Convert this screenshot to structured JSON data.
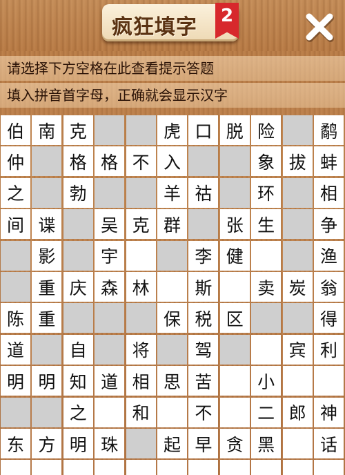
{
  "header": {
    "title": "疯狂填字",
    "level": "2",
    "close_icon": "close-x-icon"
  },
  "hints": {
    "line1": "请选择下方空格在此查看提示答题",
    "line2": "填入拼音首字母，正确就会显示汉字"
  },
  "colors": {
    "wood": "#b97b45",
    "plaque": "#f6e6c8",
    "badge_red": "#d7282c",
    "cell_white": "#ffffff",
    "cell_empty": "#cfcfcf",
    "text": "#111111"
  },
  "board": {
    "cols": 11,
    "rows": 12,
    "legend": "# = unused square, _ = blank answer square",
    "grid": [
      [
        "伯",
        "南",
        "克",
        "#",
        "#",
        "虎",
        "口",
        "脱",
        "险",
        "#",
        "鹬"
      ],
      [
        "仲",
        "#",
        "格",
        "格",
        "不",
        "入",
        "#",
        "#",
        "象",
        "拔",
        "蚌"
      ],
      [
        "之",
        "#",
        "勃",
        "#",
        "#",
        "羊",
        "祜",
        "#",
        "环",
        "#",
        "相"
      ],
      [
        "间",
        "谍",
        "#",
        "吴",
        "克",
        "群",
        "#",
        "张",
        "生",
        "#",
        "争"
      ],
      [
        "#",
        "影",
        "#",
        "宇",
        "_",
        "#",
        "李",
        "健",
        "_",
        "#",
        "渔"
      ],
      [
        "#",
        "重",
        "庆",
        "森",
        "林",
        "_",
        "斯",
        "_",
        "卖",
        "炭",
        "翁"
      ],
      [
        "陈",
        "重",
        "#",
        "#",
        "#",
        "保",
        "税",
        "区",
        "#",
        "#",
        "得"
      ],
      [
        "道",
        "#",
        "自",
        "#",
        "将",
        "#",
        "驾",
        "#",
        "_",
        "宾",
        "利"
      ],
      [
        "明",
        "明",
        "知",
        "道",
        "相",
        "思",
        "苦",
        "_",
        "小",
        "_",
        "_"
      ],
      [
        "#",
        "#",
        "之",
        "_",
        "和",
        "_",
        "不",
        "_",
        "二",
        "郎",
        "神"
      ],
      [
        "东",
        "方",
        "明",
        "珠",
        "#",
        "起",
        "早",
        "贪",
        "黑",
        "_",
        "话"
      ],
      [
        "_",
        "_",
        "_",
        "_",
        "_",
        "_",
        "_",
        "_",
        "_",
        "_",
        "_"
      ]
    ]
  }
}
